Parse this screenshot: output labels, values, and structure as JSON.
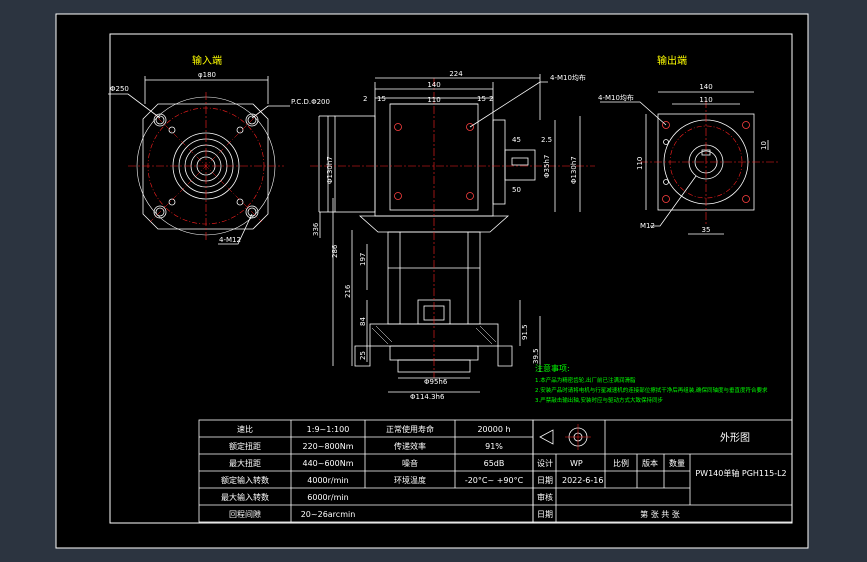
{
  "views": {
    "input_title": "输入端",
    "output_title": "输出端"
  },
  "dims": {
    "d180": "φ180",
    "d250": "Φ250",
    "pcd": "P.C.D.Φ200",
    "m12_4": "4-M12",
    "d224": "224",
    "d140": "140",
    "d110": "110",
    "d2a": "2",
    "d15a": "15",
    "d15b": "15",
    "d2b": "2",
    "m10_top": "4-M10均布",
    "d45": "45",
    "d25": "2.5",
    "d50": "50",
    "d35h7": "Φ35h7",
    "d130h7a": "Φ130h7",
    "d130h7b": "Φ130h7",
    "d336": "336",
    "d286": "286",
    "d197": "197",
    "d216": "216",
    "d84": "84",
    "d25v": "25",
    "d915": "91.5",
    "d395": "39.5",
    "d956": "Φ95h6",
    "d1143": "Φ114.3h6",
    "m10_out": "4-M10均布",
    "o140": "140",
    "o110": "110",
    "o110v": "110",
    "o10": "10",
    "om12": "M12",
    "o35": "35"
  },
  "notes": {
    "title": "注意事项:",
    "items": [
      "1.本产品为精密齿轮,出厂前已注满润滑脂",
      "2.安装产品时请将电机与行星减速机的连接部位擦拭干净后再组装,确保同轴度与垂直度符合要求",
      "3.严禁敲击输出轴,安装时应与驱动方式大致保持同步"
    ]
  },
  "spec_table": {
    "rows": [
      [
        "速比",
        "1:9~1:100",
        "正常使用寿命",
        "20000 h"
      ],
      [
        "额定扭距",
        "220~800Nm",
        "传递效率",
        "91%"
      ],
      [
        "最大扭距",
        "440~600Nm",
        "噪音",
        "65dB"
      ],
      [
        "额定输入转数",
        "4000r/min",
        "环境温度",
        "-20°C~ +90°C"
      ],
      [
        "最大输入转数",
        "6000r/min",
        "",
        ""
      ],
      [
        "回程间隙",
        "20~26arcmin",
        "",
        ""
      ]
    ]
  },
  "title_block": {
    "drawing_name": "外形图",
    "model": "PW140单轴 PGH115-L2",
    "design_label": "设计",
    "designer": "WP",
    "scale_label": "比例",
    "version_label": "版本",
    "qty_label": "数量",
    "date_label": "日期",
    "date_value": "2022-6-16",
    "check_label": "审核",
    "date_label2": "日期",
    "sheet_text": "第 张 共 张"
  },
  "colors": {
    "paper": "#000000",
    "line": "#ffffff",
    "center": "#ff2020",
    "dimension": "#ffffff",
    "title": "#ffff00",
    "notes": "#00ff00",
    "component": "#ffff00",
    "background": "#2c3440"
  }
}
